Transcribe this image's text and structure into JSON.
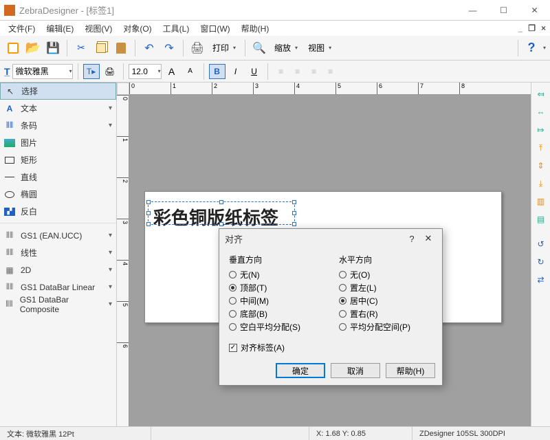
{
  "titlebar": {
    "title": "ZebraDesigner - [标签1]"
  },
  "menu": {
    "file": "文件(F)",
    "edit": "编辑(E)",
    "view": "视图(V)",
    "object": "对象(O)",
    "tools": "工具(L)",
    "window": "窗口(W)",
    "help": "帮助(H)"
  },
  "toolbar1": {
    "print": "打印",
    "zoom": "缩放",
    "viewmenu": "视图"
  },
  "toolbar2": {
    "font_name": "微软雅黑",
    "font_size": "12.0"
  },
  "toolbox": {
    "select": "选择",
    "text": "文本",
    "barcode": "条码",
    "picture": "图片",
    "rect": "矩形",
    "line": "直线",
    "ellipse": "椭圆",
    "inverse": "反白",
    "gs1_ean": "GS1 (EAN.UCC)",
    "linear": "线性",
    "twod": "2D",
    "databar_lin": "GS1 DataBar Linear",
    "databar_comp": "GS1 DataBar Composite"
  },
  "canvas": {
    "textobj": "彩色铜版纸标签"
  },
  "ruler_h": [
    "0",
    "1",
    "2",
    "3",
    "4",
    "5",
    "6",
    "7",
    "8"
  ],
  "ruler_v": [
    "0",
    "1",
    "2",
    "3",
    "4",
    "5",
    "6"
  ],
  "dialog": {
    "title": "对齐",
    "col_v": "垂直方向",
    "col_h": "水平方向",
    "v_none": "无(N)",
    "v_top": "顶部(T)",
    "v_mid": "中间(M)",
    "v_bot": "底部(B)",
    "v_space": "空白平均分配(S)",
    "h_none": "无(O)",
    "h_left": "置左(L)",
    "h_center": "居中(C)",
    "h_right": "置右(R)",
    "h_space": "平均分配空间(P)",
    "align_label": "对齐标签(A)",
    "ok": "确定",
    "cancel": "取消",
    "help": "帮助(H)"
  },
  "status": {
    "left": "文本: 微软雅黑 12Pt",
    "coord": "X: 1.68 Y:  0.85",
    "printer": "ZDesigner 105SL 300DPI"
  }
}
